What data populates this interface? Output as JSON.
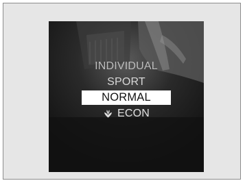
{
  "drive_mode_menu": {
    "items": [
      {
        "label": "INDIVIDUAL",
        "selected": false
      },
      {
        "label": "SPORT",
        "selected": false
      },
      {
        "label": "NORMAL",
        "selected": true
      },
      {
        "label": "ECON",
        "selected": false,
        "icon": "eco-leaf-icon"
      }
    ]
  },
  "colors": {
    "page_background": "#e6e6e6",
    "screen_background": "#141414",
    "highlight_background": "#ffffff",
    "highlight_text": "#111111",
    "menu_text": "#d8d8d8"
  }
}
